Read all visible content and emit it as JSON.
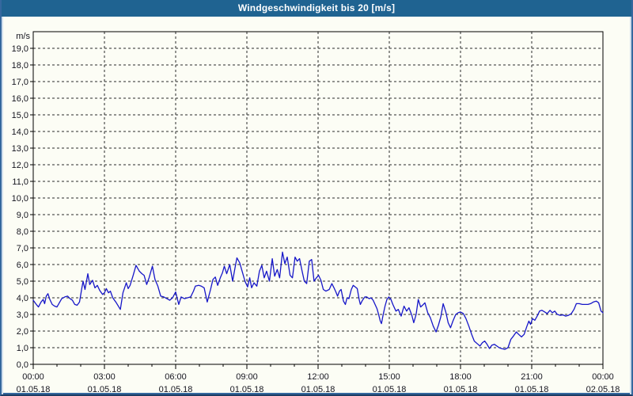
{
  "title_bar": {
    "title": "Windgeschwindigkeit bis 20 [m/s]"
  },
  "colors": {
    "title_bar_bg": "#1f6391",
    "title_bar_fg": "#ffffff",
    "page_bg": "#fcfdf5",
    "frame_border": "#35689e",
    "frame_border_dark": "#1c3c63",
    "plot_border": "#000000",
    "grid": "#2a2a2a",
    "tick_label": "#15151f",
    "line": "#1616c8"
  },
  "chart_data": {
    "type": "line",
    "title": "Windgeschwindigkeit bis 20 [m/s]",
    "ylabel": "m/s",
    "xlabel": "",
    "ylim": [
      0,
      20
    ],
    "xlim_hours": [
      0,
      24
    ],
    "grid": "dashed",
    "legend": "none",
    "y_tick_labels": [
      "0,0",
      "1,0",
      "2,0",
      "3,0",
      "4,0",
      "5,0",
      "6,0",
      "7,0",
      "8,0",
      "9,0",
      "10,0",
      "11,0",
      "12,0",
      "13,0",
      "14,0",
      "15,0",
      "16,0",
      "17,0",
      "18,0",
      "19,0"
    ],
    "x_axis": {
      "major_step_hours": 3,
      "minor_step_hours": 1,
      "majors": [
        {
          "time": "00:00",
          "date": "01.05.18"
        },
        {
          "time": "03:00",
          "date": "01.05.18"
        },
        {
          "time": "06:00",
          "date": "01.05.18"
        },
        {
          "time": "09:00",
          "date": "01.05.18"
        },
        {
          "time": "12:00",
          "date": "01.05.18"
        },
        {
          "time": "15:00",
          "date": "01.05.18"
        },
        {
          "time": "18:00",
          "date": "01.05.18"
        },
        {
          "time": "21:00",
          "date": "01.05.18"
        },
        {
          "time": "00:00",
          "date": "02.05.18"
        }
      ]
    },
    "series": [
      {
        "name": "Windgeschwindigkeit",
        "unit": "m/s",
        "color": "#1616c8",
        "points": [
          [
            0,
            3.85
          ],
          [
            0.13,
            3.6
          ],
          [
            0.22,
            3.45
          ],
          [
            0.33,
            3.75
          ],
          [
            0.42,
            3.9
          ],
          [
            0.48,
            3.65
          ],
          [
            0.55,
            4.1
          ],
          [
            0.62,
            4.25
          ],
          [
            0.7,
            3.9
          ],
          [
            0.8,
            3.6
          ],
          [
            0.9,
            3.5
          ],
          [
            1,
            3.45
          ],
          [
            1.1,
            3.7
          ],
          [
            1.2,
            3.95
          ],
          [
            1.33,
            4.05
          ],
          [
            1.45,
            4.1
          ],
          [
            1.55,
            3.95
          ],
          [
            1.65,
            3.85
          ],
          [
            1.75,
            3.6
          ],
          [
            1.85,
            3.55
          ],
          [
            1.95,
            3.75
          ],
          [
            2.05,
            4.6
          ],
          [
            2.1,
            5
          ],
          [
            2.18,
            4.5
          ],
          [
            2.3,
            5.45
          ],
          [
            2.38,
            4.8
          ],
          [
            2.5,
            5.05
          ],
          [
            2.6,
            4.6
          ],
          [
            2.7,
            4.75
          ],
          [
            2.8,
            4.45
          ],
          [
            2.92,
            4.2
          ],
          [
            3,
            4.3
          ],
          [
            3.08,
            4.55
          ],
          [
            3.17,
            4.3
          ],
          [
            3.25,
            4.4
          ],
          [
            3.35,
            4
          ],
          [
            3.5,
            3.7
          ],
          [
            3.67,
            3.3
          ],
          [
            3.78,
            4.3
          ],
          [
            3.92,
            4.9
          ],
          [
            4,
            4.55
          ],
          [
            4.08,
            4.75
          ],
          [
            4.2,
            5.3
          ],
          [
            4.33,
            5.95
          ],
          [
            4.47,
            5.6
          ],
          [
            4.58,
            5.45
          ],
          [
            4.67,
            5.35
          ],
          [
            4.78,
            4.8
          ],
          [
            4.88,
            5.2
          ],
          [
            5.02,
            5.9
          ],
          [
            5.13,
            5.1
          ],
          [
            5.25,
            4.7
          ],
          [
            5.37,
            4.1
          ],
          [
            5.5,
            4.05
          ],
          [
            5.63,
            3.95
          ],
          [
            5.75,
            3.85
          ],
          [
            5.87,
            4
          ],
          [
            6,
            4.35
          ],
          [
            6.13,
            3.6
          ],
          [
            6.23,
            4.05
          ],
          [
            6.37,
            3.95
          ],
          [
            6.5,
            4
          ],
          [
            6.63,
            4.05
          ],
          [
            6.75,
            4.4
          ],
          [
            6.83,
            4.7
          ],
          [
            6.97,
            4.75
          ],
          [
            7.08,
            4.7
          ],
          [
            7.2,
            4.6
          ],
          [
            7.33,
            3.75
          ],
          [
            7.47,
            4.5
          ],
          [
            7.57,
            5.1
          ],
          [
            7.67,
            5.25
          ],
          [
            7.77,
            4.75
          ],
          [
            7.88,
            5.2
          ],
          [
            7.97,
            5.5
          ],
          [
            8.05,
            5.9
          ],
          [
            8.15,
            5.45
          ],
          [
            8.28,
            6
          ],
          [
            8.4,
            5
          ],
          [
            8.5,
            5.8
          ],
          [
            8.58,
            6.4
          ],
          [
            8.7,
            6.1
          ],
          [
            8.8,
            5.6
          ],
          [
            8.92,
            5
          ],
          [
            9.03,
            4.65
          ],
          [
            9.12,
            5.2
          ],
          [
            9.2,
            4.6
          ],
          [
            9.3,
            4.9
          ],
          [
            9.42,
            4.7
          ],
          [
            9.53,
            5.6
          ],
          [
            9.63,
            5.95
          ],
          [
            9.73,
            5.2
          ],
          [
            9.83,
            5.6
          ],
          [
            9.95,
            5
          ],
          [
            10.07,
            6.35
          ],
          [
            10.17,
            5.3
          ],
          [
            10.28,
            5.7
          ],
          [
            10.38,
            5.2
          ],
          [
            10.5,
            6.75
          ],
          [
            10.6,
            6.05
          ],
          [
            10.7,
            6.45
          ],
          [
            10.82,
            5.35
          ],
          [
            10.92,
            5.2
          ],
          [
            11.03,
            6.45
          ],
          [
            11.12,
            6.2
          ],
          [
            11.22,
            6.35
          ],
          [
            11.32,
            5.65
          ],
          [
            11.42,
            5
          ],
          [
            11.52,
            4.85
          ],
          [
            11.63,
            6.2
          ],
          [
            11.73,
            6.3
          ],
          [
            11.83,
            5
          ],
          [
            11.93,
            5.2
          ],
          [
            12.02,
            5.35
          ],
          [
            12.12,
            5.05
          ],
          [
            12.22,
            4.5
          ],
          [
            12.33,
            4.4
          ],
          [
            12.47,
            4.5
          ],
          [
            12.58,
            4.85
          ],
          [
            12.67,
            4.6
          ],
          [
            12.75,
            4.35
          ],
          [
            12.82,
            4.1
          ],
          [
            12.9,
            4.4
          ],
          [
            12.97,
            4.5
          ],
          [
            13.07,
            3.8
          ],
          [
            13.15,
            3.6
          ],
          [
            13.22,
            4
          ],
          [
            13.3,
            3.95
          ],
          [
            13.4,
            4.5
          ],
          [
            13.48,
            4.75
          ],
          [
            13.57,
            4.65
          ],
          [
            13.65,
            4.55
          ],
          [
            13.73,
            3.9
          ],
          [
            13.78,
            3.6
          ],
          [
            13.87,
            3.85
          ],
          [
            13.97,
            4.05
          ],
          [
            14.05,
            4.05
          ],
          [
            14.15,
            3.95
          ],
          [
            14.23,
            4
          ],
          [
            14.32,
            3.85
          ],
          [
            14.4,
            3.6
          ],
          [
            14.48,
            3.35
          ],
          [
            14.55,
            3
          ],
          [
            14.62,
            2.6
          ],
          [
            14.67,
            2.45
          ],
          [
            14.73,
            2.9
          ],
          [
            14.82,
            3.5
          ],
          [
            14.9,
            3.9
          ],
          [
            14.98,
            4.05
          ],
          [
            15.07,
            3.9
          ],
          [
            15.15,
            3.6
          ],
          [
            15.28,
            3.2
          ],
          [
            15.38,
            3.3
          ],
          [
            15.5,
            2.9
          ],
          [
            15.62,
            3.5
          ],
          [
            15.73,
            3.2
          ],
          [
            15.83,
            3.4
          ],
          [
            15.95,
            2.95
          ],
          [
            16.03,
            2.5
          ],
          [
            16.13,
            3
          ],
          [
            16.22,
            3.9
          ],
          [
            16.32,
            3.45
          ],
          [
            16.4,
            3.55
          ],
          [
            16.5,
            3.7
          ],
          [
            16.62,
            3.1
          ],
          [
            16.73,
            2.8
          ],
          [
            16.85,
            2.3
          ],
          [
            16.97,
            1.95
          ],
          [
            17.07,
            2.35
          ],
          [
            17.17,
            2.85
          ],
          [
            17.27,
            3.65
          ],
          [
            17.38,
            3.15
          ],
          [
            17.48,
            2.5
          ],
          [
            17.58,
            2.2
          ],
          [
            17.68,
            2.6
          ],
          [
            17.8,
            3
          ],
          [
            17.9,
            3.1
          ],
          [
            18,
            3.15
          ],
          [
            18.12,
            3.05
          ],
          [
            18.23,
            2.75
          ],
          [
            18.35,
            2.3
          ],
          [
            18.47,
            1.8
          ],
          [
            18.58,
            1.4
          ],
          [
            18.7,
            1.25
          ],
          [
            18.82,
            1.1
          ],
          [
            18.92,
            1.3
          ],
          [
            19.02,
            1.4
          ],
          [
            19.12,
            1.2
          ],
          [
            19.22,
            0.95
          ],
          [
            19.32,
            1.15
          ],
          [
            19.43,
            1.2
          ],
          [
            19.53,
            1.1
          ],
          [
            19.63,
            1
          ],
          [
            19.73,
            0.95
          ],
          [
            19.87,
            0.9
          ],
          [
            20,
            1
          ],
          [
            20.12,
            1.5
          ],
          [
            20.23,
            1.7
          ],
          [
            20.35,
            1.95
          ],
          [
            20.45,
            1.8
          ],
          [
            20.57,
            1.65
          ],
          [
            20.68,
            1.8
          ],
          [
            20.8,
            2.3
          ],
          [
            20.88,
            2.6
          ],
          [
            20.95,
            2.4
          ],
          [
            21.03,
            2.75
          ],
          [
            21.13,
            2.65
          ],
          [
            21.23,
            2.9
          ],
          [
            21.33,
            3.2
          ],
          [
            21.43,
            3.25
          ],
          [
            21.55,
            3.15
          ],
          [
            21.65,
            3.05
          ],
          [
            21.77,
            3.25
          ],
          [
            21.87,
            3.1
          ],
          [
            21.97,
            3.2
          ],
          [
            22.08,
            3
          ],
          [
            22.2,
            2.95
          ],
          [
            22.32,
            2.97
          ],
          [
            22.43,
            2.9
          ],
          [
            22.55,
            2.95
          ],
          [
            22.67,
            3.05
          ],
          [
            22.78,
            3.3
          ],
          [
            22.88,
            3.65
          ],
          [
            23,
            3.65
          ],
          [
            23.13,
            3.6
          ],
          [
            23.25,
            3.6
          ],
          [
            23.37,
            3.6
          ],
          [
            23.48,
            3.65
          ],
          [
            23.6,
            3.75
          ],
          [
            23.72,
            3.8
          ],
          [
            23.82,
            3.7
          ],
          [
            23.92,
            3.2
          ],
          [
            24,
            3.1
          ]
        ]
      }
    ]
  }
}
